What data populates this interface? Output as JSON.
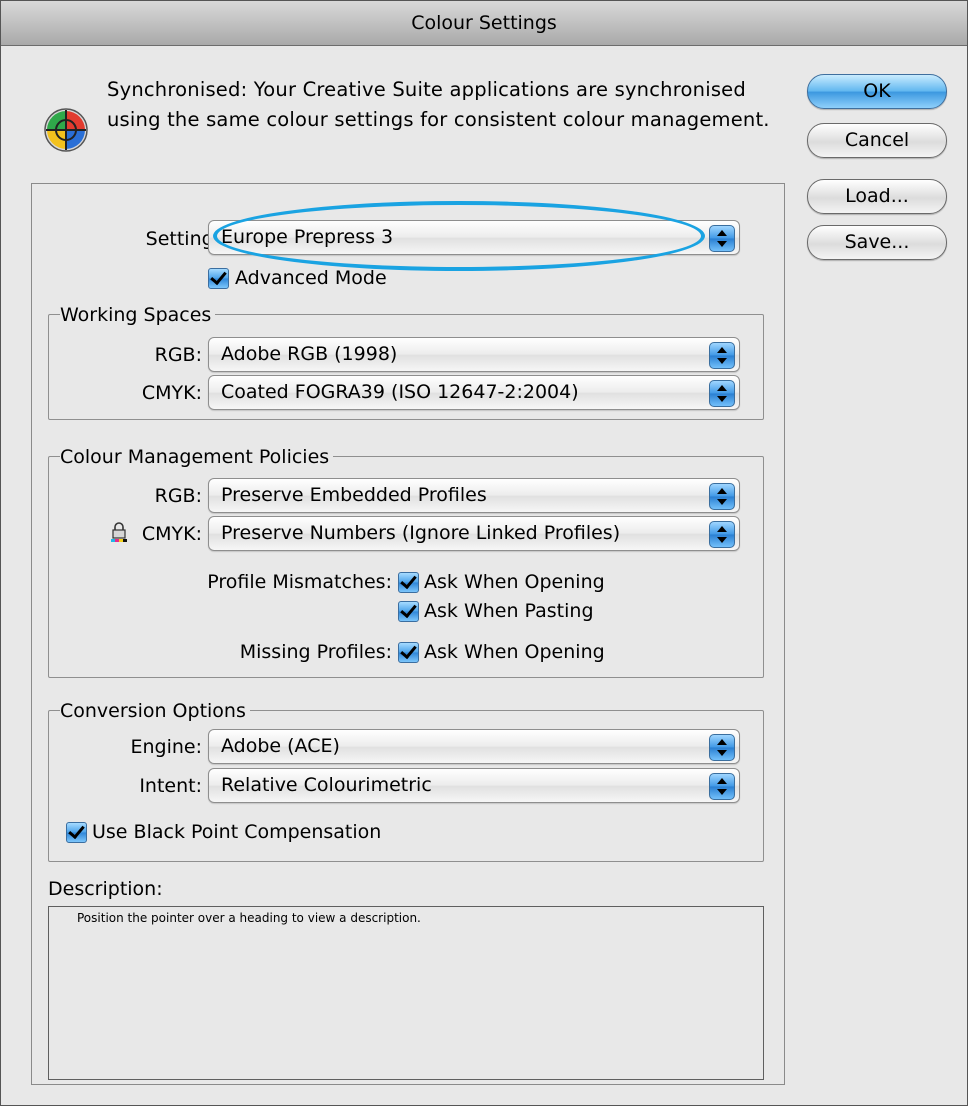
{
  "window": {
    "title": "Colour Settings"
  },
  "sync": {
    "line1": "Synchronised: Your Creative Suite applications are synchronised",
    "line2": "using the same colour settings for consistent colour management.",
    "icon": "color-wheel-icon"
  },
  "buttons": {
    "ok": "OK",
    "cancel": "Cancel",
    "load": "Load...",
    "save": "Save..."
  },
  "settings": {
    "label": "Settings:",
    "value": "Europe Prepress 3",
    "advanced_label": "Advanced Mode",
    "advanced_checked": true
  },
  "working_spaces": {
    "title": "Working Spaces",
    "rgb_label": "RGB:",
    "rgb_value": "Adobe RGB (1998)",
    "cmyk_label": "CMYK:",
    "cmyk_value": "Coated FOGRA39 (ISO 12647-2:2004)"
  },
  "policies": {
    "title": "Colour Management Policies",
    "rgb_label": "RGB:",
    "rgb_value": "Preserve Embedded Profiles",
    "cmyk_label": "CMYK:",
    "cmyk_value": "Preserve Numbers (Ignore Linked Profiles)",
    "cmyk_icon": "lock-icon",
    "mismatch_label": "Profile Mismatches:",
    "mismatch_open": "Ask When Opening",
    "mismatch_paste": "Ask When Pasting",
    "missing_label": "Missing Profiles:",
    "missing_open": "Ask When Opening"
  },
  "conversion": {
    "title": "Conversion Options",
    "engine_label": "Engine:",
    "engine_value": "Adobe (ACE)",
    "intent_label": "Intent:",
    "intent_value": "Relative Colourimetric",
    "bpc_label": "Use Black Point Compensation",
    "bpc_checked": true
  },
  "description": {
    "label": "Description:",
    "text": "Position the pointer over a heading to view a description."
  },
  "colors": {
    "accent": "#1aa3e2",
    "window_bg": "#e8e8e8"
  }
}
